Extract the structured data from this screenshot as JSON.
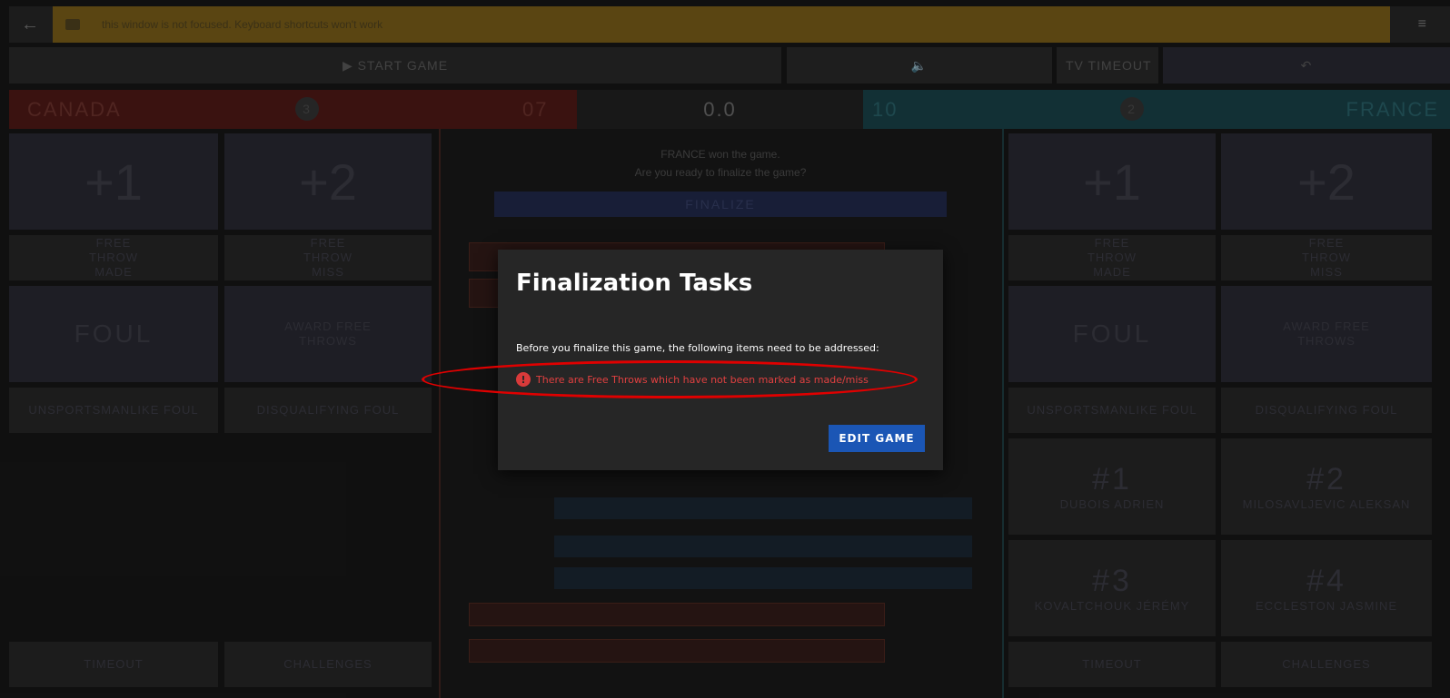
{
  "topbar": {
    "back_icon": "arrow-left-icon",
    "banner_text": "this window is not focused. Keyboard shortcuts won't work",
    "menu_icon": "hamburger-menu-icon"
  },
  "controls": {
    "start_game": "▶ START GAME",
    "sound_icon": "speaker-icon",
    "tv_timeout": "TV TIMEOUT",
    "undo_icon": "undo-icon"
  },
  "score": {
    "home_team": "CANADA",
    "home_fouls": "3",
    "home_score": "07",
    "clock": "0.0",
    "away_score": "10",
    "away_fouls": "2",
    "away_team": "FRANCE"
  },
  "home_panel": {
    "plus1": "+1",
    "plus2": "+2",
    "ft_made": "FREE THROW MADE",
    "ft_miss": "FREE THROW MISS",
    "foul": "FOUL",
    "award_ft": "AWARD FREE THROWS",
    "unsportsmanlike": "UNSPORTSMANLIKE FOUL",
    "disqualifying": "DISQUALIFYING FOUL",
    "timeout": "TIMEOUT",
    "challenges": "CHALLENGES"
  },
  "away_panel": {
    "plus1": "+1",
    "plus2": "+2",
    "ft_made": "FREE THROW MADE",
    "ft_miss": "FREE THROW MISS",
    "foul": "FOUL",
    "award_ft": "AWARD FREE THROWS",
    "unsportsmanlike": "UNSPORTSMANLIKE FOUL",
    "disqualifying": "DISQUALIFYING FOUL",
    "players": [
      {
        "number": "#1",
        "name": "DUBOIS ADRIEN"
      },
      {
        "number": "#2",
        "name": "MILOSAVLJEVIC ALEKSAN"
      },
      {
        "number": "#3",
        "name": "KOVALTCHOUK JÉRÉMY"
      },
      {
        "number": "#4",
        "name": "ECCLESTON JASMINE"
      }
    ],
    "timeout": "TIMEOUT",
    "challenges": "CHALLENGES"
  },
  "center": {
    "winner_line": "FRANCE won the game.",
    "ready_line": "Are you ready to finalize the game?",
    "finalize": "FINALIZE"
  },
  "dialog": {
    "title": "Finalization Tasks",
    "intro": "Before you finalize this game, the following items need to be addressed:",
    "warning": "There are Free Throws which have not been marked as made/miss",
    "warning_icon": "alert-circle-icon",
    "edit_button": "EDIT GAME"
  },
  "colors": {
    "home": "#5a1d1a",
    "away": "#1d4a52",
    "accent": "#1b56b5",
    "warning": "#e04040",
    "annotation_ring": "#e00000"
  }
}
